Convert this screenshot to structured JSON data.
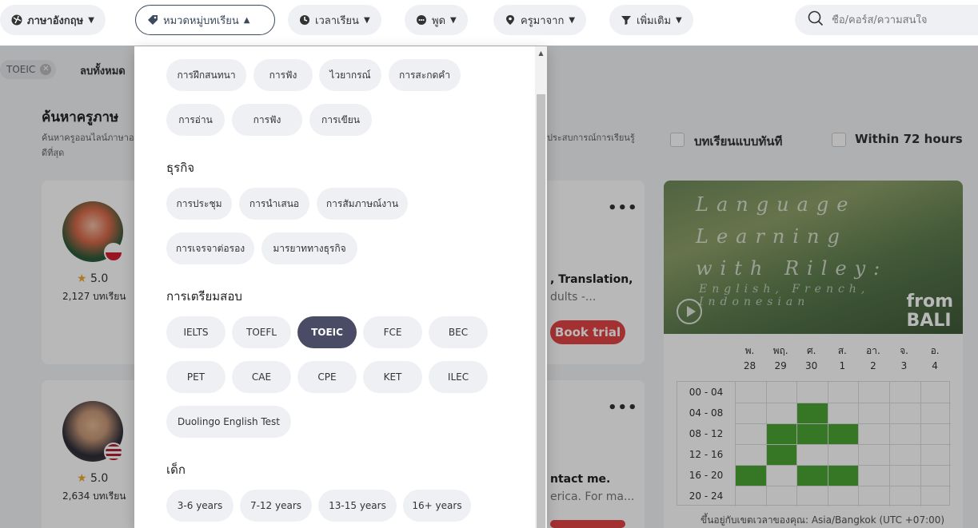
{
  "filters": {
    "language": "ภาษาอังกฤษ",
    "category": "หมวดหมู่บทเรียน",
    "time": "เวลาเรียน",
    "speaks": "พูด",
    "from": "ครูมาจาก",
    "more": "เพิ่มเติม",
    "search_placeholder": "ชื่อ/คอร์ส/ความสนใจ"
  },
  "active_tag": "TOEIC",
  "clear_all": "ลบทั้งหมด",
  "heading": "ค้นหาครูภาษ",
  "subheading": "ค้นหาครูออนไลน์ภาษาอ ที่ดีที่สุด",
  "subheading_right": "ประสบการณ์การเรียนรู้",
  "instant_label": "บทเรียนแบบทันที",
  "within_label": "Within 72 hours",
  "teachers": [
    {
      "rating": "5.0",
      "lessons": "2,127 บทเรียน",
      "title": ", Translation,",
      "desc": "dults -..."
    },
    {
      "rating": "5.0",
      "lessons": "2,634 บทเรียน",
      "title": "ntact me.",
      "desc": "erica. For ma..."
    }
  ],
  "book_label": "Book trial",
  "video": {
    "title_lines": [
      "Language",
      "Learning",
      "with Riley:"
    ],
    "subtitle": "English, French, Indonesian",
    "from_lines": [
      "from",
      "BALI"
    ]
  },
  "schedule": {
    "days": [
      {
        "name": "พ.",
        "date": "28"
      },
      {
        "name": "พฤ.",
        "date": "29"
      },
      {
        "name": "ศ.",
        "date": "30"
      },
      {
        "name": "ส.",
        "date": "1"
      },
      {
        "name": "อา.",
        "date": "2"
      },
      {
        "name": "จ.",
        "date": "3"
      },
      {
        "name": "อ.",
        "date": "4"
      }
    ],
    "slots": [
      "00 - 04",
      "04 - 08",
      "08 - 12",
      "12 - 16",
      "16 - 20",
      "20 - 24"
    ],
    "available": [
      [
        1,
        2
      ],
      [
        2,
        1
      ],
      [
        2,
        2
      ],
      [
        2,
        3
      ],
      [
        3,
        1
      ],
      [
        4,
        0
      ],
      [
        4,
        2
      ],
      [
        4,
        3
      ]
    ],
    "available_color": "#4aa534",
    "timezone": "ขึ้นอยู่กับเขตเวลาของคุณ: Asia/Bangkok (UTC +07:00)"
  },
  "dropdown": {
    "general_row1": [
      "การฝึกสนทนา",
      "การฟัง",
      "ไวยากรณ์",
      "การสะกดคำ"
    ],
    "general_row2": [
      "การอ่าน",
      "การฟัง",
      "การเขียน"
    ],
    "business_title": "ธุรกิจ",
    "business_row1": [
      "การประชุม",
      "การนำเสนอ",
      "การสัมภาษณ์งาน"
    ],
    "business_row2": [
      "การเจรจาต่อรอง",
      "มารยาททางธุรกิจ"
    ],
    "exam_title": "การเตรียมสอบ",
    "exam_row1": [
      "IELTS",
      "TOEFL",
      "TOEIC",
      "FCE",
      "BEC"
    ],
    "exam_row2": [
      "PET",
      "CAE",
      "CPE",
      "KET",
      "ILEC"
    ],
    "exam_row3": [
      "Duolingo English Test"
    ],
    "kids_title": "เด็ก",
    "kids_row1": [
      "3-6 years",
      "7-12 years",
      "13-15 years",
      "16+ years"
    ],
    "selected": "TOEIC"
  }
}
